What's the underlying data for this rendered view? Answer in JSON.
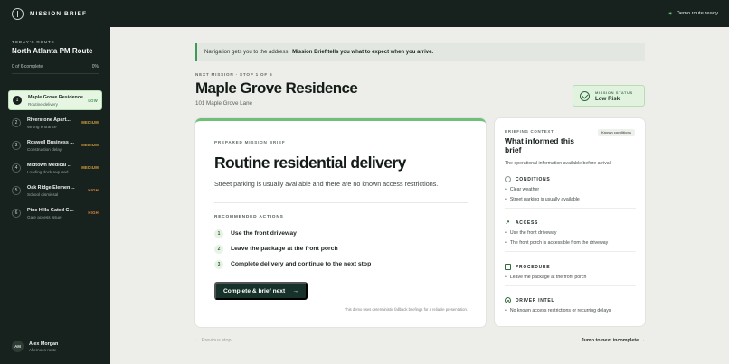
{
  "app": {
    "brand": "MISSION BRIEF",
    "status": "Demo route ready"
  },
  "sidebar": {
    "route_label": "TODAY'S ROUTE",
    "route_title": "North Atlanta PM Route",
    "progress_text": "0 of 6 complete",
    "progress_percent": "0%",
    "progress_value": 0,
    "stops": [
      {
        "num": "1",
        "name": "Maple Grove Residence",
        "sub": "Routine delivery",
        "risk": "LOW"
      },
      {
        "num": "2",
        "name": "Riverstone Apart...",
        "sub": "Wrong entrance",
        "risk": "MEDIUM"
      },
      {
        "num": "3",
        "name": "Roswell Business ...",
        "sub": "Construction delay",
        "risk": "MEDIUM"
      },
      {
        "num": "4",
        "name": "Midtown Medical ...",
        "sub": "Loading dock required",
        "risk": "MEDIUM"
      },
      {
        "num": "5",
        "name": "Oak Ridge Elementar...",
        "sub": "School dismissal",
        "risk": "HIGH"
      },
      {
        "num": "6",
        "name": "Pine Hills Gated Com...",
        "sub": "Gate access issue",
        "risk": "HIGH"
      }
    ],
    "user": {
      "initials": "AM",
      "name": "Alex Morgan",
      "sub": "Afternoon route"
    }
  },
  "banner": {
    "text": "Navigation gets you to the address.",
    "emphasis": "Mission Brief tells you what to expect when you arrive."
  },
  "mission": {
    "eyebrow": "NEXT MISSION · STOP 1 OF 6",
    "title": "Maple Grove Residence",
    "address": "101 Maple Grove Lane",
    "status_label": "MISSION STATUS",
    "status_value": "Low Risk"
  },
  "brief": {
    "eyebrow": "PREPARED MISSION BRIEF",
    "title": "Routine residential delivery",
    "description": "Street parking is usually available and there are no known access restrictions.",
    "actions_label": "RECOMMENDED ACTIONS",
    "actions": [
      {
        "num": "1",
        "text": "Use the front driveway"
      },
      {
        "num": "2",
        "text": "Leave the package at the front porch"
      },
      {
        "num": "3",
        "text": "Complete delivery and continue to the next stop"
      }
    ],
    "cta_label": "Complete & brief next",
    "cta_arrow": "→",
    "footnote": "This demo uses deterministic fallback briefings for a reliable presentation."
  },
  "context": {
    "label": "BRIEFING CONTEXT",
    "title": "What informed this brief",
    "chip": "Known conditions",
    "description": "The operational information available before arrival.",
    "sections": [
      {
        "title": "CONDITIONS",
        "icon": "cloud-icon",
        "items": [
          "Clear weather",
          "Street parking is usually available"
        ]
      },
      {
        "title": "ACCESS",
        "icon": "arrow-up-right-icon",
        "items": [
          "Use the front driveway",
          "The front porch is accessible from the driveway"
        ]
      },
      {
        "title": "PROCEDURE",
        "icon": "box-icon",
        "items": [
          "Leave the package at the front porch"
        ]
      },
      {
        "title": "DRIVER INTEL",
        "icon": "target-icon",
        "items": [
          "No known access restrictions or recurring delays"
        ]
      }
    ]
  },
  "footer": {
    "prev": "← Previous stop",
    "next": "Jump to next incomplete →"
  }
}
